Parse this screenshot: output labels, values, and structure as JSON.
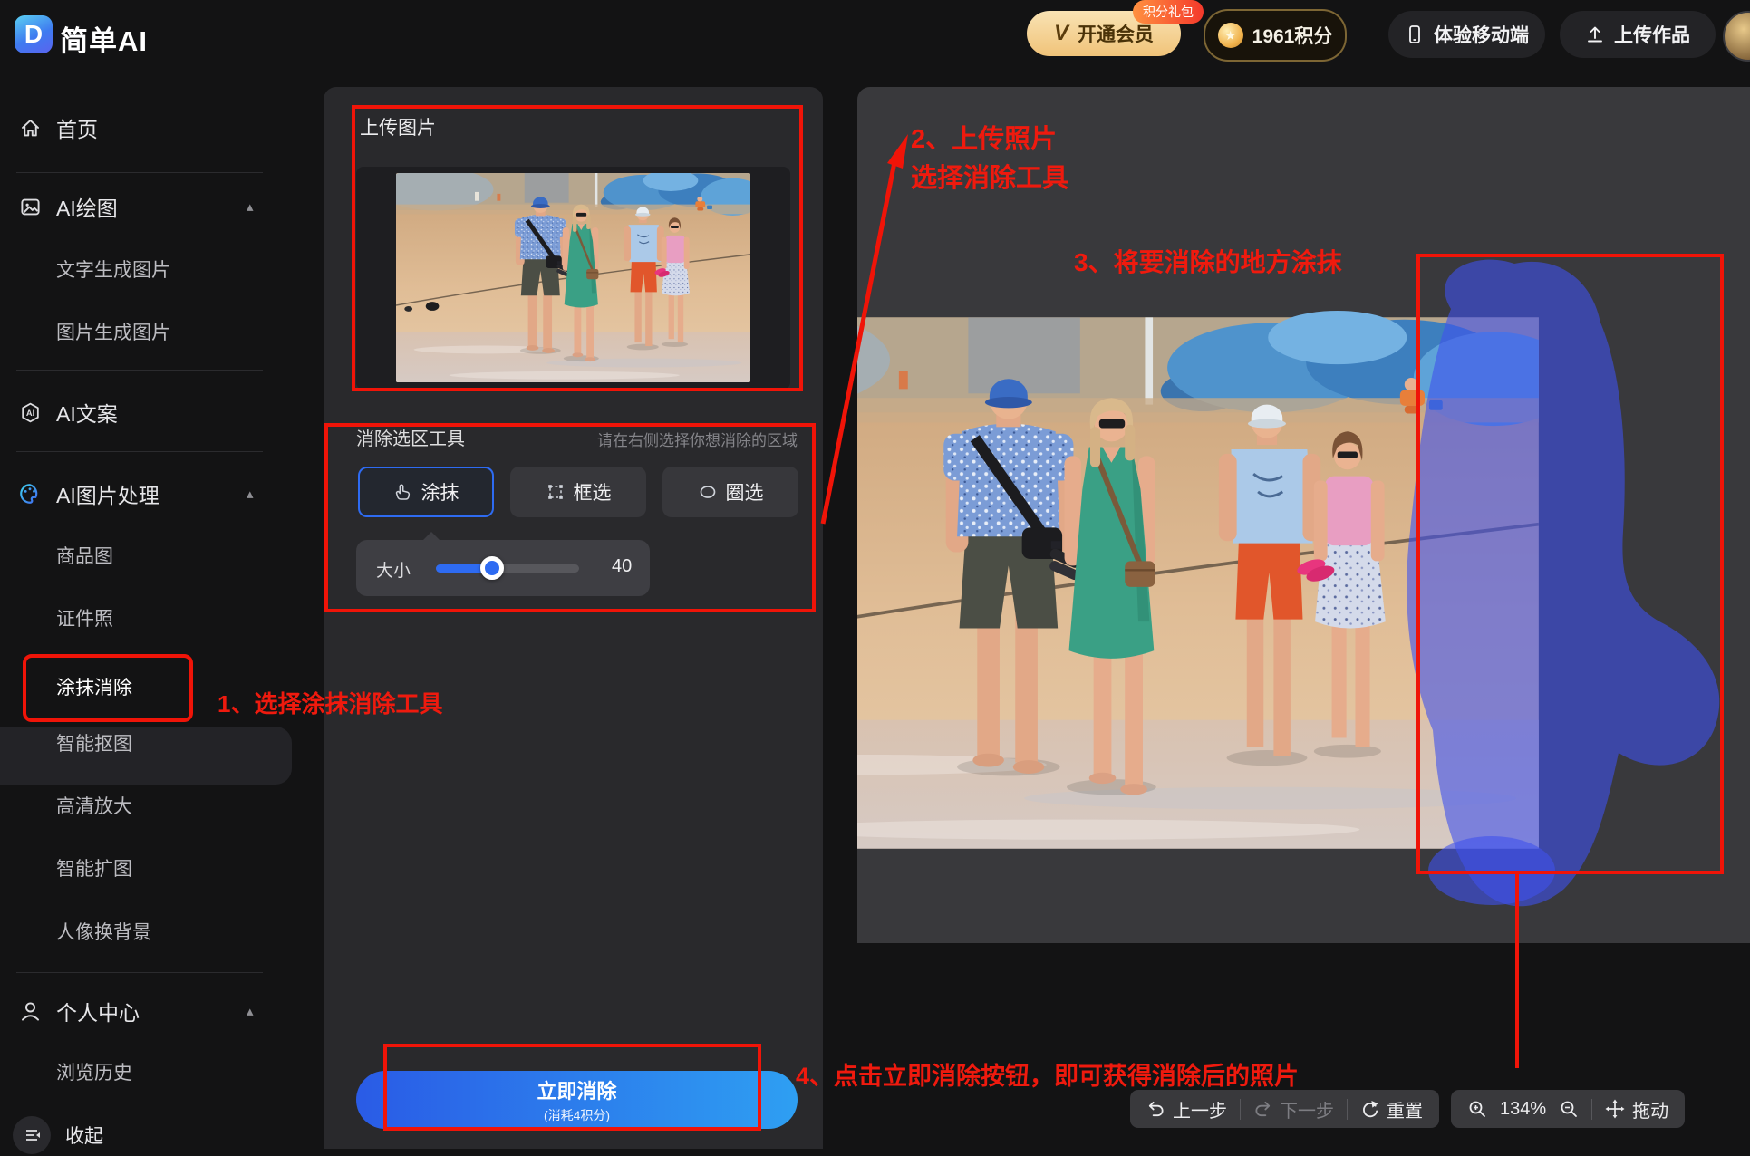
{
  "header": {
    "logo_letter": "D",
    "logo_text": "简单AI",
    "vip_v": "V",
    "vip_button": "开通会员",
    "vip_badge": "积分礼包",
    "coin_star": "★",
    "points_label": "1961积分",
    "mobile_button": "体验移动端",
    "upload_button": "上传作品"
  },
  "sidebar": {
    "home": "首页",
    "groups": [
      {
        "label": "AI绘图",
        "children": [
          "文字生成图片",
          "图片生成图片"
        ]
      },
      {
        "label": "AI文案",
        "children": []
      },
      {
        "label": "AI图片处理",
        "children": [
          "商品图",
          "证件照",
          "涂抹消除",
          "智能抠图",
          "高清放大",
          "智能扩图",
          "人像换背景"
        ]
      },
      {
        "label": "个人中心",
        "children": [
          "浏览历史"
        ]
      }
    ],
    "active_item": "涂抹消除",
    "collapse_label": "收起"
  },
  "glyphs": {
    "chevron_up": "▴"
  },
  "panel": {
    "upload_title": "上传图片",
    "tools_title": "消除选区工具",
    "tools_hint": "请在右侧选择你想消除的区域",
    "tools": [
      "涂抹",
      "框选",
      "圈选"
    ],
    "size_label": "大小",
    "size_value": "40",
    "submit_label": "立即消除",
    "submit_note": "(消耗4积分)"
  },
  "canvas_toolbar": {
    "undo": "上一步",
    "redo": "下一步",
    "reset": "重置",
    "zoom_level": "134%",
    "drag": "拖动"
  },
  "annotations": {
    "step1": "1、选择涂抹消除工具",
    "step2_line1": "2、上传照片",
    "step2_line2": "选择消除工具",
    "step3": "3、将要消除的地方涂抹",
    "step4": "4、点击立即消除按钮，即可获得消除后的照片"
  },
  "colors": {
    "accent_blue": "#2e6bf2",
    "annotation_red": "#f01408",
    "mask_blue": "#3f51ec",
    "vip_gold": "#f0c379",
    "panel_bg": "#29292c",
    "workspace_bg": "#39393c"
  },
  "icons": [
    "logo-icon",
    "vip-v-icon",
    "coin-icon",
    "phone-icon",
    "upload-icon",
    "home-icon",
    "gallery-icon",
    "ai-doc-icon",
    "palette-icon",
    "user-icon",
    "collapse-icon",
    "hand-smear-icon",
    "marquee-icon",
    "lasso-icon",
    "undo-icon",
    "redo-icon",
    "reset-icon",
    "zoom-in-icon",
    "zoom-out-icon",
    "move-icon",
    "chevron-up-icon"
  ]
}
